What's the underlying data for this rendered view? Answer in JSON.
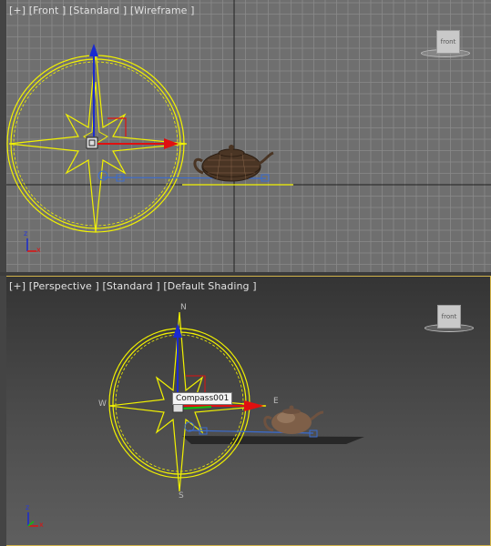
{
  "front_viewport": {
    "label": {
      "plus": "[+]",
      "view": "[Front ]",
      "style": "[Standard ]",
      "shading": "[Wireframe ]"
    },
    "viewcube_label": "front"
  },
  "perspective_viewport": {
    "label": {
      "plus": "[+]",
      "view": "[Perspective ]",
      "style": "[Standard ]",
      "shading": "[Default Shading ]"
    },
    "viewcube_label": "front",
    "compass_letters": {
      "north": "N",
      "south": "S",
      "east": "E",
      "west": "W"
    }
  },
  "tooltip": "Compass001",
  "axes": {
    "x": "x",
    "y": "y",
    "z": "z"
  },
  "colors": {
    "selection_yellow": "#f2f200",
    "gizmo_x": "#e01010",
    "gizmo_y": "#10c010",
    "gizmo_z": "#1a2ad0",
    "grid_line": "#8a8a8a",
    "active_border": "#d2b34a"
  }
}
